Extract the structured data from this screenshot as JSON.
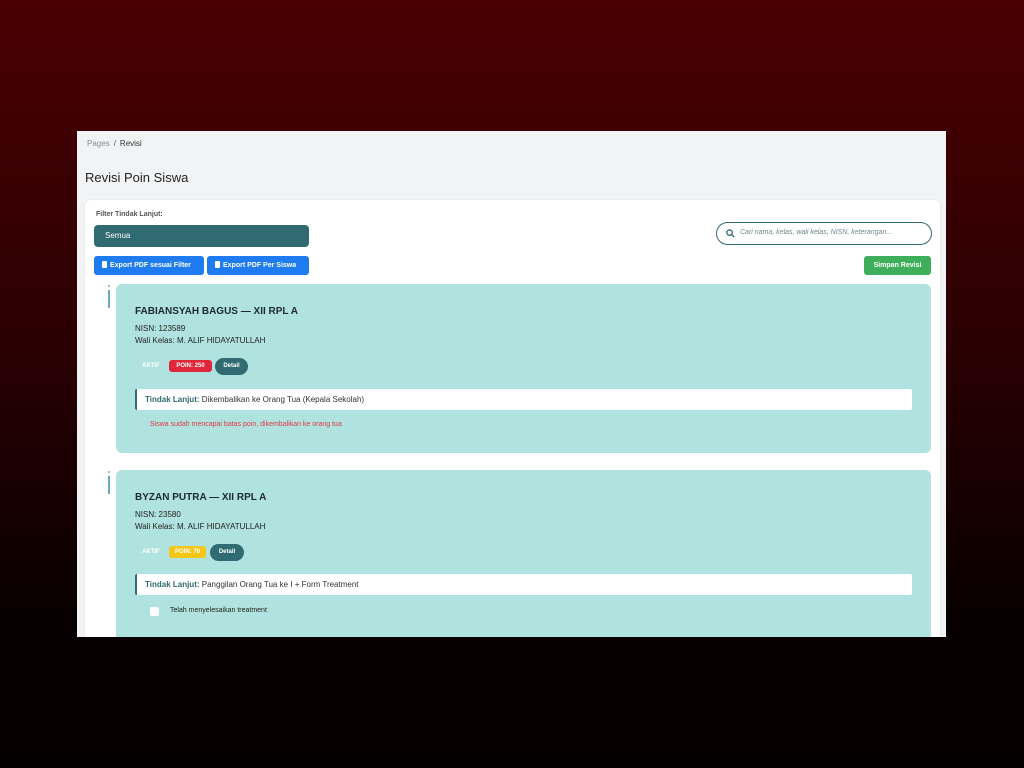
{
  "breadcrumb": {
    "root": "Pages",
    "separator": "/",
    "current": "Revisi"
  },
  "page": {
    "title": "Revisi Poin Siswa"
  },
  "filter": {
    "label": "Filter Tindak Lanjut:",
    "selected": "Semua"
  },
  "search": {
    "placeholder": "Cari nama, kelas, wali kelas, NISN, keterangan..."
  },
  "toolbar": {
    "export_filter": "Export PDF sesuai Filter",
    "export_per_siswa": "Export PDF Per Siswa",
    "save": "Simpan Revisi"
  },
  "students": [
    {
      "name": "FABIANSYAH BAGUS — XII RPL A",
      "nisn": "NISN: 123589",
      "wali": "Wali Kelas: M. ALIF HIDAYATULLAH",
      "status": "AKTIF",
      "poin": "POIN: 250",
      "poin_color": "#e0263b",
      "detail": "Detail",
      "tindak_label": "Tindak Lanjut:",
      "tindak_value": "Dikembalikan ke Orang Tua (Kepala Sekolah)",
      "note": "Siswa sudah mencapai batas poin, dikembalikan ke orang tua"
    },
    {
      "name": "BYZAN PUTRA — XII RPL A",
      "nisn": "NISN: 23580",
      "wali": "Wali Kelas: M. ALIF HIDAYATULLAH",
      "status": "AKTIF",
      "poin": "POIN: 70",
      "poin_color": "#f5c518",
      "detail": "Detail",
      "tindak_label": "Tindak Lanjut:",
      "tindak_value": "Panggilan Orang Tua ke I + Form Treatment",
      "checkbox_label": "Telah menyelesaikan treatment",
      "checkbox_checked": false
    }
  ]
}
